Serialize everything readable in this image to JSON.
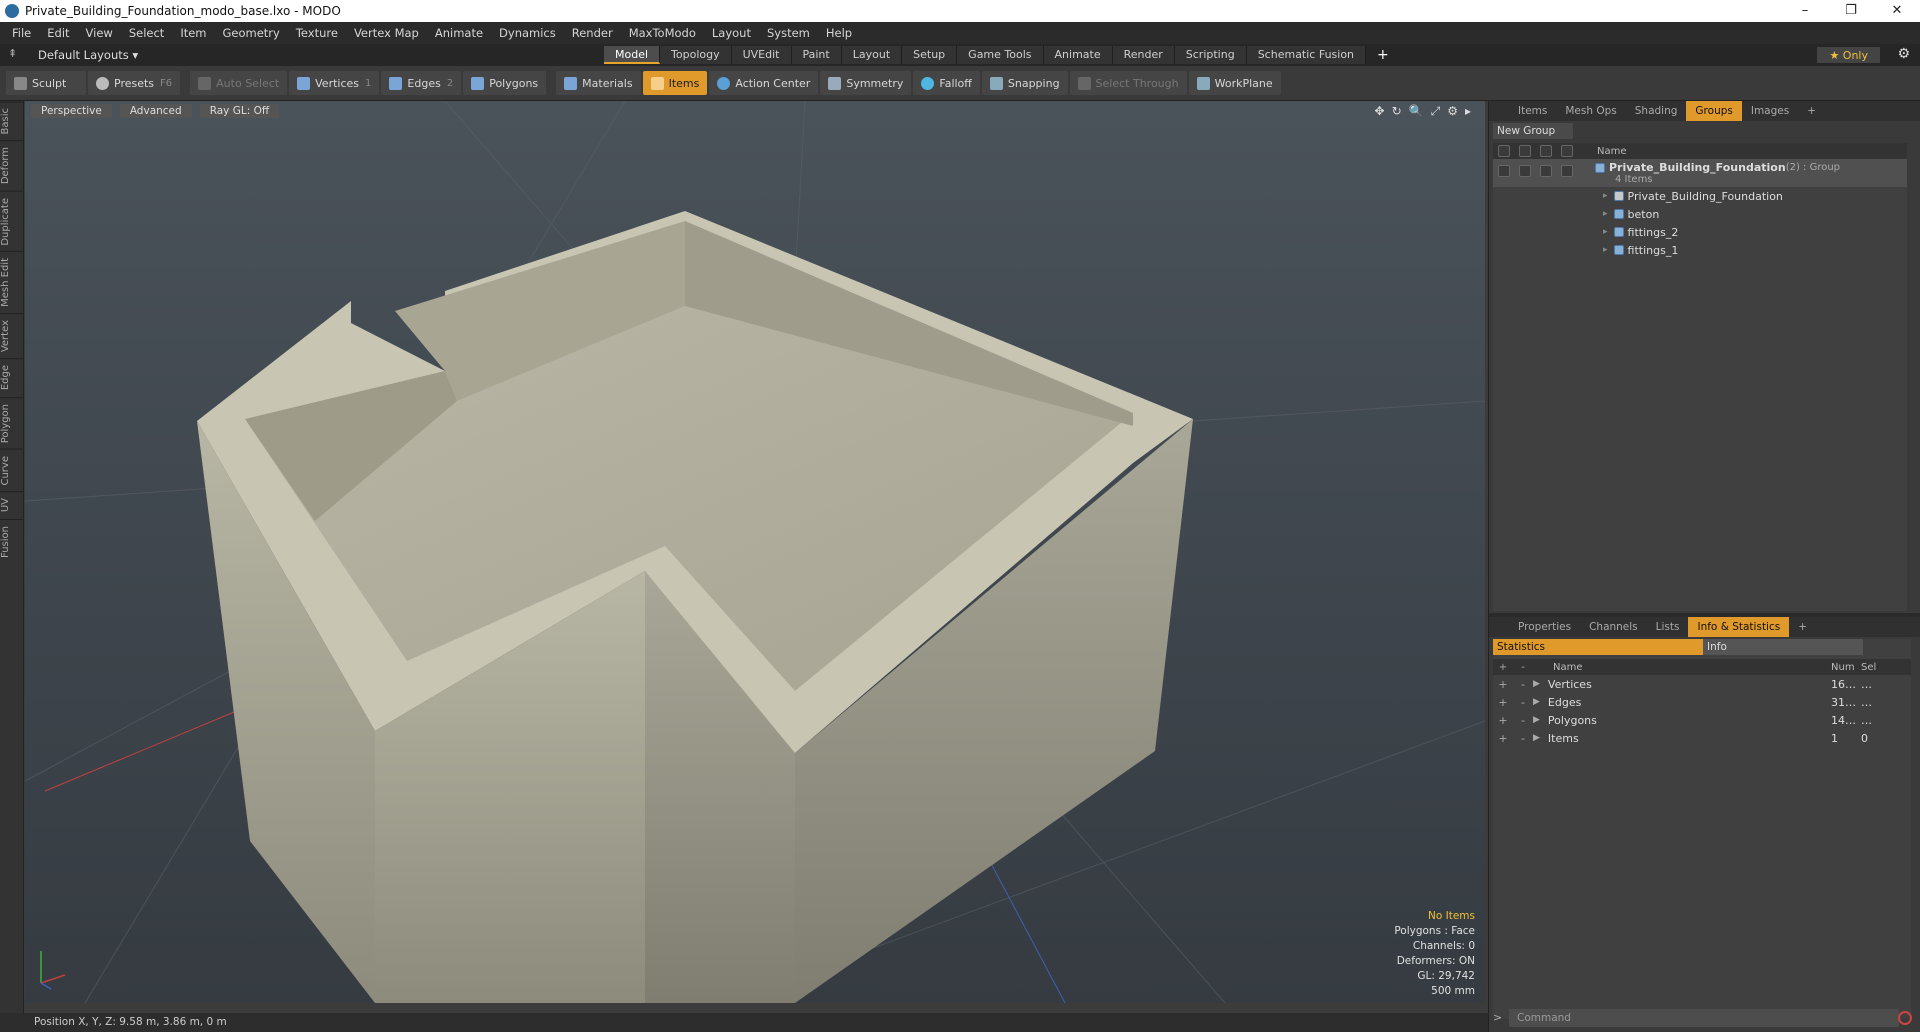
{
  "window": {
    "title": "Private_Building_Foundation_modo_base.lxo - MODO",
    "min": "–",
    "max": "❐",
    "close": "✕"
  },
  "menu": [
    "File",
    "Edit",
    "View",
    "Select",
    "Item",
    "Geometry",
    "Texture",
    "Vertex Map",
    "Animate",
    "Dynamics",
    "Render",
    "MaxToModo",
    "Layout",
    "System",
    "Help"
  ],
  "layoutbar": {
    "layout": "Default Layouts ▾",
    "tabs": [
      "Model",
      "Topology",
      "UVEdit",
      "Paint",
      "Layout",
      "Setup",
      "Game Tools",
      "Animate",
      "Render",
      "Scripting",
      "Schematic Fusion"
    ],
    "add": "+",
    "only": "★  Only",
    "gear": "⚙"
  },
  "toolbar": {
    "sculpt": "Sculpt",
    "presets": "Presets",
    "presets_key": "F6",
    "auto_select": "Auto Select",
    "vertices": "Vertices",
    "vertices_key": "1",
    "edges": "Edges",
    "edges_key": "2",
    "polygons": "Polygons",
    "materials": "Materials",
    "items": "Items",
    "action_center": "Action Center",
    "symmetry": "Symmetry",
    "falloff": "Falloff",
    "snapping": "Snapping",
    "select_through": "Select Through",
    "workplane": "WorkPlane"
  },
  "leftstrip": [
    "Basic",
    "Deform",
    "Duplicate",
    "Mesh Edit",
    "Vertex",
    "Edge",
    "Polygon",
    "Curve",
    "UV",
    "Fusion"
  ],
  "viewport": {
    "perspective": "Perspective",
    "advanced": "Advanced",
    "raygl": "Ray GL: Off",
    "tools": [
      "✥",
      "↻",
      "🔍",
      "⤢",
      "⚙",
      "▸"
    ],
    "info": {
      "no_items": "No Items",
      "polygons": "Polygons : Face",
      "channels": "Channels: 0",
      "deformers": "Deformers: ON",
      "gl": "GL: 29,742",
      "scale": "500 mm"
    }
  },
  "status": {
    "position": "Position X, Y, Z:  9.58 m, 3.86 m, 0 m"
  },
  "rightpanel": {
    "tabs": [
      "Items",
      "Mesh Ops",
      "Shading",
      "Groups",
      "Images",
      "+"
    ],
    "new_group": "New Group",
    "name_col": "Name",
    "group_name": "Private_Building_Foundation",
    "group_suffix": " (2) : Group",
    "group_count": "4 Items",
    "children": [
      "Private_Building_Foundation",
      "beton",
      "fittings_2",
      "fittings_1"
    ],
    "tabs2": [
      "Properties",
      "Channels",
      "Lists",
      "Info & Statistics",
      "+"
    ],
    "stat_tabs": [
      "Statistics",
      "Info"
    ],
    "stat_cols": {
      "name": "Name",
      "num": "Num",
      "sel": "Sel"
    },
    "stats": [
      {
        "name": "Vertices",
        "num": "16…",
        "sel": "…"
      },
      {
        "name": "Edges",
        "num": "31…",
        "sel": "…"
      },
      {
        "name": "Polygons",
        "num": "14…",
        "sel": "…"
      },
      {
        "name": "Items",
        "num": "1",
        "sel": "0"
      }
    ],
    "command": "Command"
  },
  "colors": {
    "accent": "#e09a2c",
    "bg": "#3a3a3a"
  }
}
